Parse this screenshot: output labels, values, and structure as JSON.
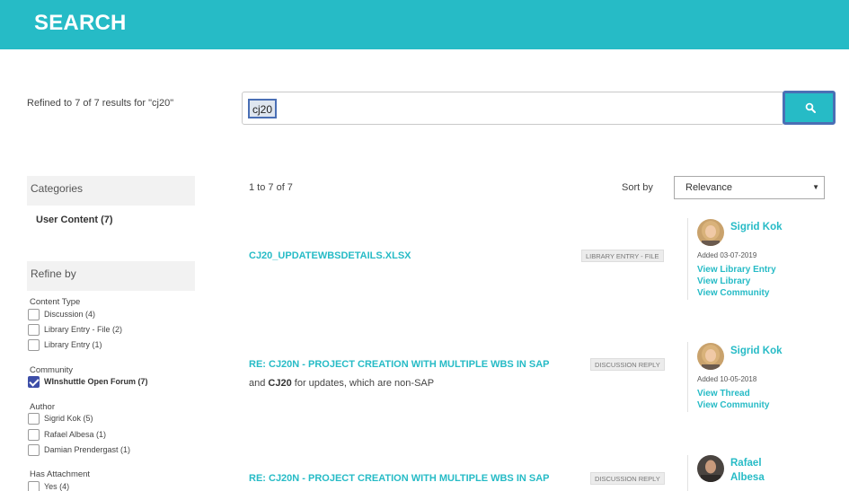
{
  "header": {
    "title": "SEARCH"
  },
  "search": {
    "refined_text": "Refined to 7 of 7 results for \"cj20\"",
    "query": "cj20"
  },
  "categories": {
    "title": "Categories",
    "item": "User Content (7)"
  },
  "refine": {
    "title": "Refine by",
    "content_type": {
      "label": "Content Type",
      "options": [
        "Discussion (4)",
        "Library Entry - File (2)",
        "Library Entry (1)"
      ]
    },
    "community": {
      "label": "Community",
      "options": [
        "WInshuttle Open Forum (7)"
      ]
    },
    "author": {
      "label": "Author",
      "options": [
        "Sigrid Kok (5)",
        "Rafael Albesa (1)",
        "Damian Prendergast (1)"
      ]
    },
    "attachment": {
      "label": "Has Attachment",
      "options": [
        "Yes (4)"
      ]
    }
  },
  "results_bar": {
    "count": "1 to 7 of 7",
    "sort_label": "Sort by",
    "sort_value": "Relevance"
  },
  "results": [
    {
      "title": "CJ20_UPDATEWBSDETAILS.XLSX",
      "badge": "LIBRARY ENTRY - FILE",
      "author": "Sigrid Kok",
      "added": "Added 03-07-2019",
      "links": [
        "View Library Entry",
        "View Library",
        "View Community"
      ]
    },
    {
      "title": "RE: CJ20N - PROJECT CREATION WITH MULTIPLE WBS IN SAP",
      "badge": "DISCUSSION REPLY",
      "snippet_pre": "and ",
      "snippet_bold": "CJ20",
      "snippet_post": " for updates, which are non-SAP",
      "author": "Sigrid Kok",
      "added": "Added 10-05-2018",
      "links": [
        "View Thread",
        "View Community"
      ]
    },
    {
      "title": "RE: CJ20N - PROJECT CREATION WITH MULTIPLE WBS IN SAP",
      "badge": "DISCUSSION REPLY",
      "author_first": "Rafael",
      "author_last": "Albesa"
    }
  ],
  "colors": {
    "accent": "#26bbc6",
    "highlight_border": "#4a6fb5",
    "checked": "#3d4ea8"
  }
}
